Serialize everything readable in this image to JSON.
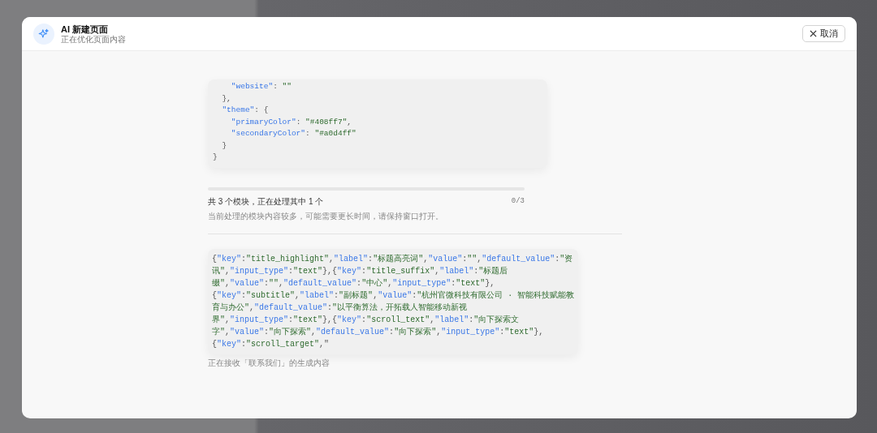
{
  "dialog": {
    "title": "AI 新建页面",
    "subtitle": "正在优化页面内容",
    "cancel_button": "取消"
  },
  "code_block_1": {
    "lines": [
      [
        {
          "kind": "key",
          "text": "    \"website\""
        },
        {
          "kind": "punct",
          "text": ": "
        },
        {
          "kind": "string",
          "text": "\"\""
        }
      ],
      [
        {
          "kind": "punct",
          "text": "  },"
        }
      ],
      [
        {
          "kind": "key",
          "text": "  \"theme\""
        },
        {
          "kind": "punct",
          "text": ": {"
        }
      ],
      [
        {
          "kind": "key",
          "text": "    \"primaryColor\""
        },
        {
          "kind": "punct",
          "text": ": "
        },
        {
          "kind": "string",
          "text": "\"#408ff7\""
        },
        {
          "kind": "punct",
          "text": ","
        }
      ],
      [
        {
          "kind": "key",
          "text": "    \"secondaryColor\""
        },
        {
          "kind": "punct",
          "text": ": "
        },
        {
          "kind": "string",
          "text": "\"#a0d4ff\""
        }
      ],
      [
        {
          "kind": "punct",
          "text": "  }"
        }
      ],
      [
        {
          "kind": "punct",
          "text": "}"
        }
      ]
    ]
  },
  "progress": {
    "summary": "共 3 个模块，正在处理其中 1 个",
    "count": "0/3",
    "level": 0,
    "note": "当前处理的模块内容较多，可能需要更长时间，请保持窗口打开。"
  },
  "code_block_2": {
    "lines": [
      [
        {
          "kind": "punct",
          "text": "{"
        },
        {
          "kind": "key",
          "text": "\"key\""
        },
        {
          "kind": "punct",
          "text": ":"
        },
        {
          "kind": "string",
          "text": "\"title_highlight\""
        },
        {
          "kind": "punct",
          "text": ","
        },
        {
          "kind": "key",
          "text": "\"label\""
        },
        {
          "kind": "punct",
          "text": ":"
        },
        {
          "kind": "string",
          "text": "\"标题高亮词\""
        },
        {
          "kind": "punct",
          "text": ","
        },
        {
          "kind": "key",
          "text": "\"value\""
        },
        {
          "kind": "punct",
          "text": ":"
        },
        {
          "kind": "string",
          "text": "\"\""
        },
        {
          "kind": "punct",
          "text": ","
        },
        {
          "kind": "key",
          "text": "\"default_value\""
        },
        {
          "kind": "punct",
          "text": ":"
        },
        {
          "kind": "string",
          "text": "\"资"
        }
      ],
      [
        {
          "kind": "string",
          "text": "讯\""
        },
        {
          "kind": "punct",
          "text": ","
        },
        {
          "kind": "key",
          "text": "\"input_type\""
        },
        {
          "kind": "punct",
          "text": ":"
        },
        {
          "kind": "string",
          "text": "\"text\""
        },
        {
          "kind": "punct",
          "text": "},{"
        },
        {
          "kind": "key",
          "text": "\"key\""
        },
        {
          "kind": "punct",
          "text": ":"
        },
        {
          "kind": "string",
          "text": "\"title_suffix\""
        },
        {
          "kind": "punct",
          "text": ","
        },
        {
          "kind": "key",
          "text": "\"label\""
        },
        {
          "kind": "punct",
          "text": ":"
        },
        {
          "kind": "string",
          "text": "\"标题后"
        }
      ],
      [
        {
          "kind": "string",
          "text": "缀\""
        },
        {
          "kind": "punct",
          "text": ","
        },
        {
          "kind": "key",
          "text": "\"value\""
        },
        {
          "kind": "punct",
          "text": ":"
        },
        {
          "kind": "string",
          "text": "\"\""
        },
        {
          "kind": "punct",
          "text": ","
        },
        {
          "kind": "key",
          "text": "\"default_value\""
        },
        {
          "kind": "punct",
          "text": ":"
        },
        {
          "kind": "string",
          "text": "\"中心\""
        },
        {
          "kind": "punct",
          "text": ","
        },
        {
          "kind": "key",
          "text": "\"input_type\""
        },
        {
          "kind": "punct",
          "text": ":"
        },
        {
          "kind": "string",
          "text": "\"text\""
        },
        {
          "kind": "punct",
          "text": "},"
        }
      ],
      [
        {
          "kind": "punct",
          "text": "{"
        },
        {
          "kind": "key",
          "text": "\"key\""
        },
        {
          "kind": "punct",
          "text": ":"
        },
        {
          "kind": "string",
          "text": "\"subtitle\""
        },
        {
          "kind": "punct",
          "text": ","
        },
        {
          "kind": "key",
          "text": "\"label\""
        },
        {
          "kind": "punct",
          "text": ":"
        },
        {
          "kind": "string",
          "text": "\"副标题\""
        },
        {
          "kind": "punct",
          "text": ","
        },
        {
          "kind": "key",
          "text": "\"value\""
        },
        {
          "kind": "punct",
          "text": ":"
        },
        {
          "kind": "string",
          "text": "\"杭州官微科技有限公司 · 智能科技赋能教"
        }
      ],
      [
        {
          "kind": "string",
          "text": "育与办公\""
        },
        {
          "kind": "punct",
          "text": ","
        },
        {
          "kind": "key",
          "text": "\"default_value\""
        },
        {
          "kind": "punct",
          "text": ":"
        },
        {
          "kind": "string",
          "text": "\"以平衡算法，开拓载人智能移动新视"
        }
      ],
      [
        {
          "kind": "string",
          "text": "界\""
        },
        {
          "kind": "punct",
          "text": ","
        },
        {
          "kind": "key",
          "text": "\"input_type\""
        },
        {
          "kind": "punct",
          "text": ":"
        },
        {
          "kind": "string",
          "text": "\"text\""
        },
        {
          "kind": "punct",
          "text": "},{"
        },
        {
          "kind": "key",
          "text": "\"key\""
        },
        {
          "kind": "punct",
          "text": ":"
        },
        {
          "kind": "string",
          "text": "\"scroll_text\""
        },
        {
          "kind": "punct",
          "text": ","
        },
        {
          "kind": "key",
          "text": "\"label\""
        },
        {
          "kind": "punct",
          "text": ":"
        },
        {
          "kind": "string",
          "text": "\"向下探索文"
        }
      ],
      [
        {
          "kind": "string",
          "text": "字\""
        },
        {
          "kind": "punct",
          "text": ","
        },
        {
          "kind": "key",
          "text": "\"value\""
        },
        {
          "kind": "punct",
          "text": ":"
        },
        {
          "kind": "string",
          "text": "\"向下探索\""
        },
        {
          "kind": "punct",
          "text": ","
        },
        {
          "kind": "key",
          "text": "\"default_value\""
        },
        {
          "kind": "punct",
          "text": ":"
        },
        {
          "kind": "string",
          "text": "\"向下探索\""
        },
        {
          "kind": "punct",
          "text": ","
        },
        {
          "kind": "key",
          "text": "\"input_type\""
        },
        {
          "kind": "punct",
          "text": ":"
        },
        {
          "kind": "string",
          "text": "\"text\""
        },
        {
          "kind": "punct",
          "text": "},"
        }
      ],
      [
        {
          "kind": "punct",
          "text": "{"
        },
        {
          "kind": "key",
          "text": "\"key\""
        },
        {
          "kind": "punct",
          "text": ":"
        },
        {
          "kind": "string",
          "text": "\"scroll_target\""
        },
        {
          "kind": "punct",
          "text": ",\""
        }
      ]
    ]
  },
  "status_text": "正在接收「联系我们」的生成内容"
}
